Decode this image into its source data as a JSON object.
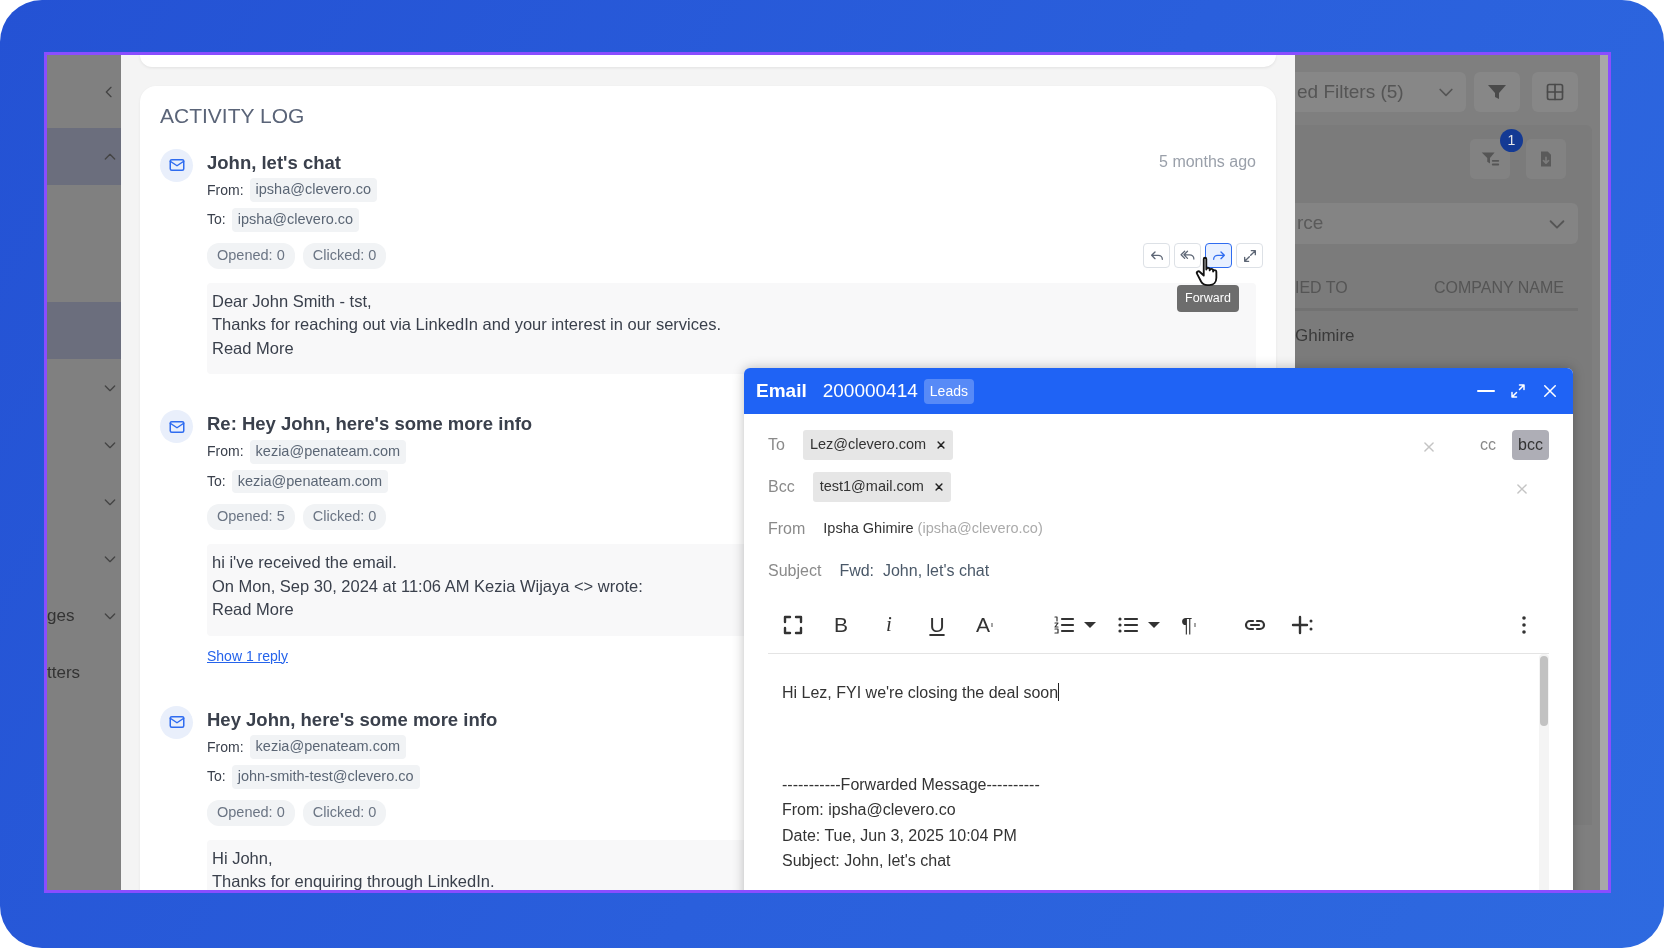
{
  "sidebar": {
    "items": [
      {
        "expanded": true,
        "selected": true,
        "children": [
          {
            "selected": true
          }
        ]
      },
      {
        "expanded": false,
        "selected": false
      },
      {
        "expanded": false,
        "selected": false
      },
      {
        "expanded": false,
        "selected": false
      },
      {
        "expanded": false,
        "selected": false
      },
      {
        "label": "ges",
        "expanded": false,
        "selected": false
      },
      {
        "label": "tters",
        "selected": false
      }
    ]
  },
  "activity_log": {
    "title": "ACTIVITY LOG",
    "entries": [
      {
        "subject": "John, let's chat",
        "time": "5 months ago",
        "from_label": "From:",
        "from": "ipsha@clevero.co",
        "to_label": "To:",
        "to": "ipsha@clevero.co",
        "opened": "Opened: 0",
        "clicked": "Clicked: 0",
        "body": [
          "Dear John Smith - tst,",
          "Thanks for reaching out via LinkedIn and your interest in our services."
        ],
        "read_more": "Read More",
        "actions": [
          {
            "kind": "reply",
            "selected": false
          },
          {
            "kind": "reply-all",
            "selected": false
          },
          {
            "kind": "forward",
            "selected": true
          },
          {
            "kind": "expand",
            "selected": false
          }
        ],
        "tooltip": "Forward"
      },
      {
        "subject": "Re: Hey John, here's some more info",
        "from_label": "From:",
        "from": "kezia@penateam.com",
        "to_label": "To:",
        "to": "kezia@penateam.com",
        "opened": "Opened: 5",
        "clicked": "Clicked: 0",
        "body": [
          "hi i've received the email.",
          "On Mon, Sep 30, 2024 at 11:06 AM Kezia Wijaya <> wrote:"
        ],
        "read_more": "Read More",
        "replies_link": "Show 1 reply"
      },
      {
        "subject": "Hey John, here's some more info",
        "from_label": "From:",
        "from": "kezia@penateam.com",
        "to_label": "To:",
        "to": "john-smith-test@clevero.co",
        "opened": "Opened: 0",
        "clicked": "Clicked: 0",
        "body": [
          "Hi John,",
          "Thanks for enquiring through LinkedIn."
        ]
      }
    ]
  },
  "right_panel": {
    "filter_select": "ed Filters (5)",
    "filter_badge": "1",
    "source_select": "rce",
    "columns": [
      "IED TO",
      "COMPANY NAME"
    ],
    "rows": [
      [
        "Ghimire"
      ]
    ]
  },
  "email_composer": {
    "title": "Email",
    "record_id": "200000414",
    "tag": "Leads",
    "fields": [
      {
        "kind": "recipients",
        "label": "To",
        "chips": [
          "Lez@clevero.com"
        ],
        "clearable": true,
        "toggles": [
          {
            "label": "cc",
            "selected": false
          },
          {
            "label": "bcc",
            "selected": true
          }
        ]
      },
      {
        "kind": "recipients",
        "label": "Bcc",
        "chips": [
          "test1@mail.com"
        ],
        "clearable": true
      },
      {
        "kind": "sender",
        "label": "From",
        "name": "Ipsha Ghimire",
        "email": "(ipsha@clevero.co)"
      },
      {
        "kind": "subject",
        "label": "Subject",
        "value": "Fwd:  John, let's chat"
      }
    ],
    "toolbar": [
      {
        "kind": "fullscreen"
      },
      {
        "kind": "bold",
        "label": "B"
      },
      {
        "kind": "italic",
        "label": "i"
      },
      {
        "kind": "underline",
        "label": "U"
      },
      {
        "kind": "font",
        "label": "A"
      },
      {
        "kind": "ordered-list",
        "menu": true
      },
      {
        "kind": "bullet-list",
        "menu": true
      },
      {
        "kind": "paragraph",
        "label": "¶"
      },
      {
        "kind": "link"
      },
      {
        "kind": "insert"
      },
      {
        "kind": "more"
      }
    ],
    "message": "Hi Lez, FYI we're closing the deal soon",
    "forwarded": [
      "-----------Forwarded Message----------",
      "From: ipsha@clevero.co",
      "Date: Tue, Jun 3, 2025 10:04 PM",
      "Subject: John, let's chat"
    ]
  }
}
